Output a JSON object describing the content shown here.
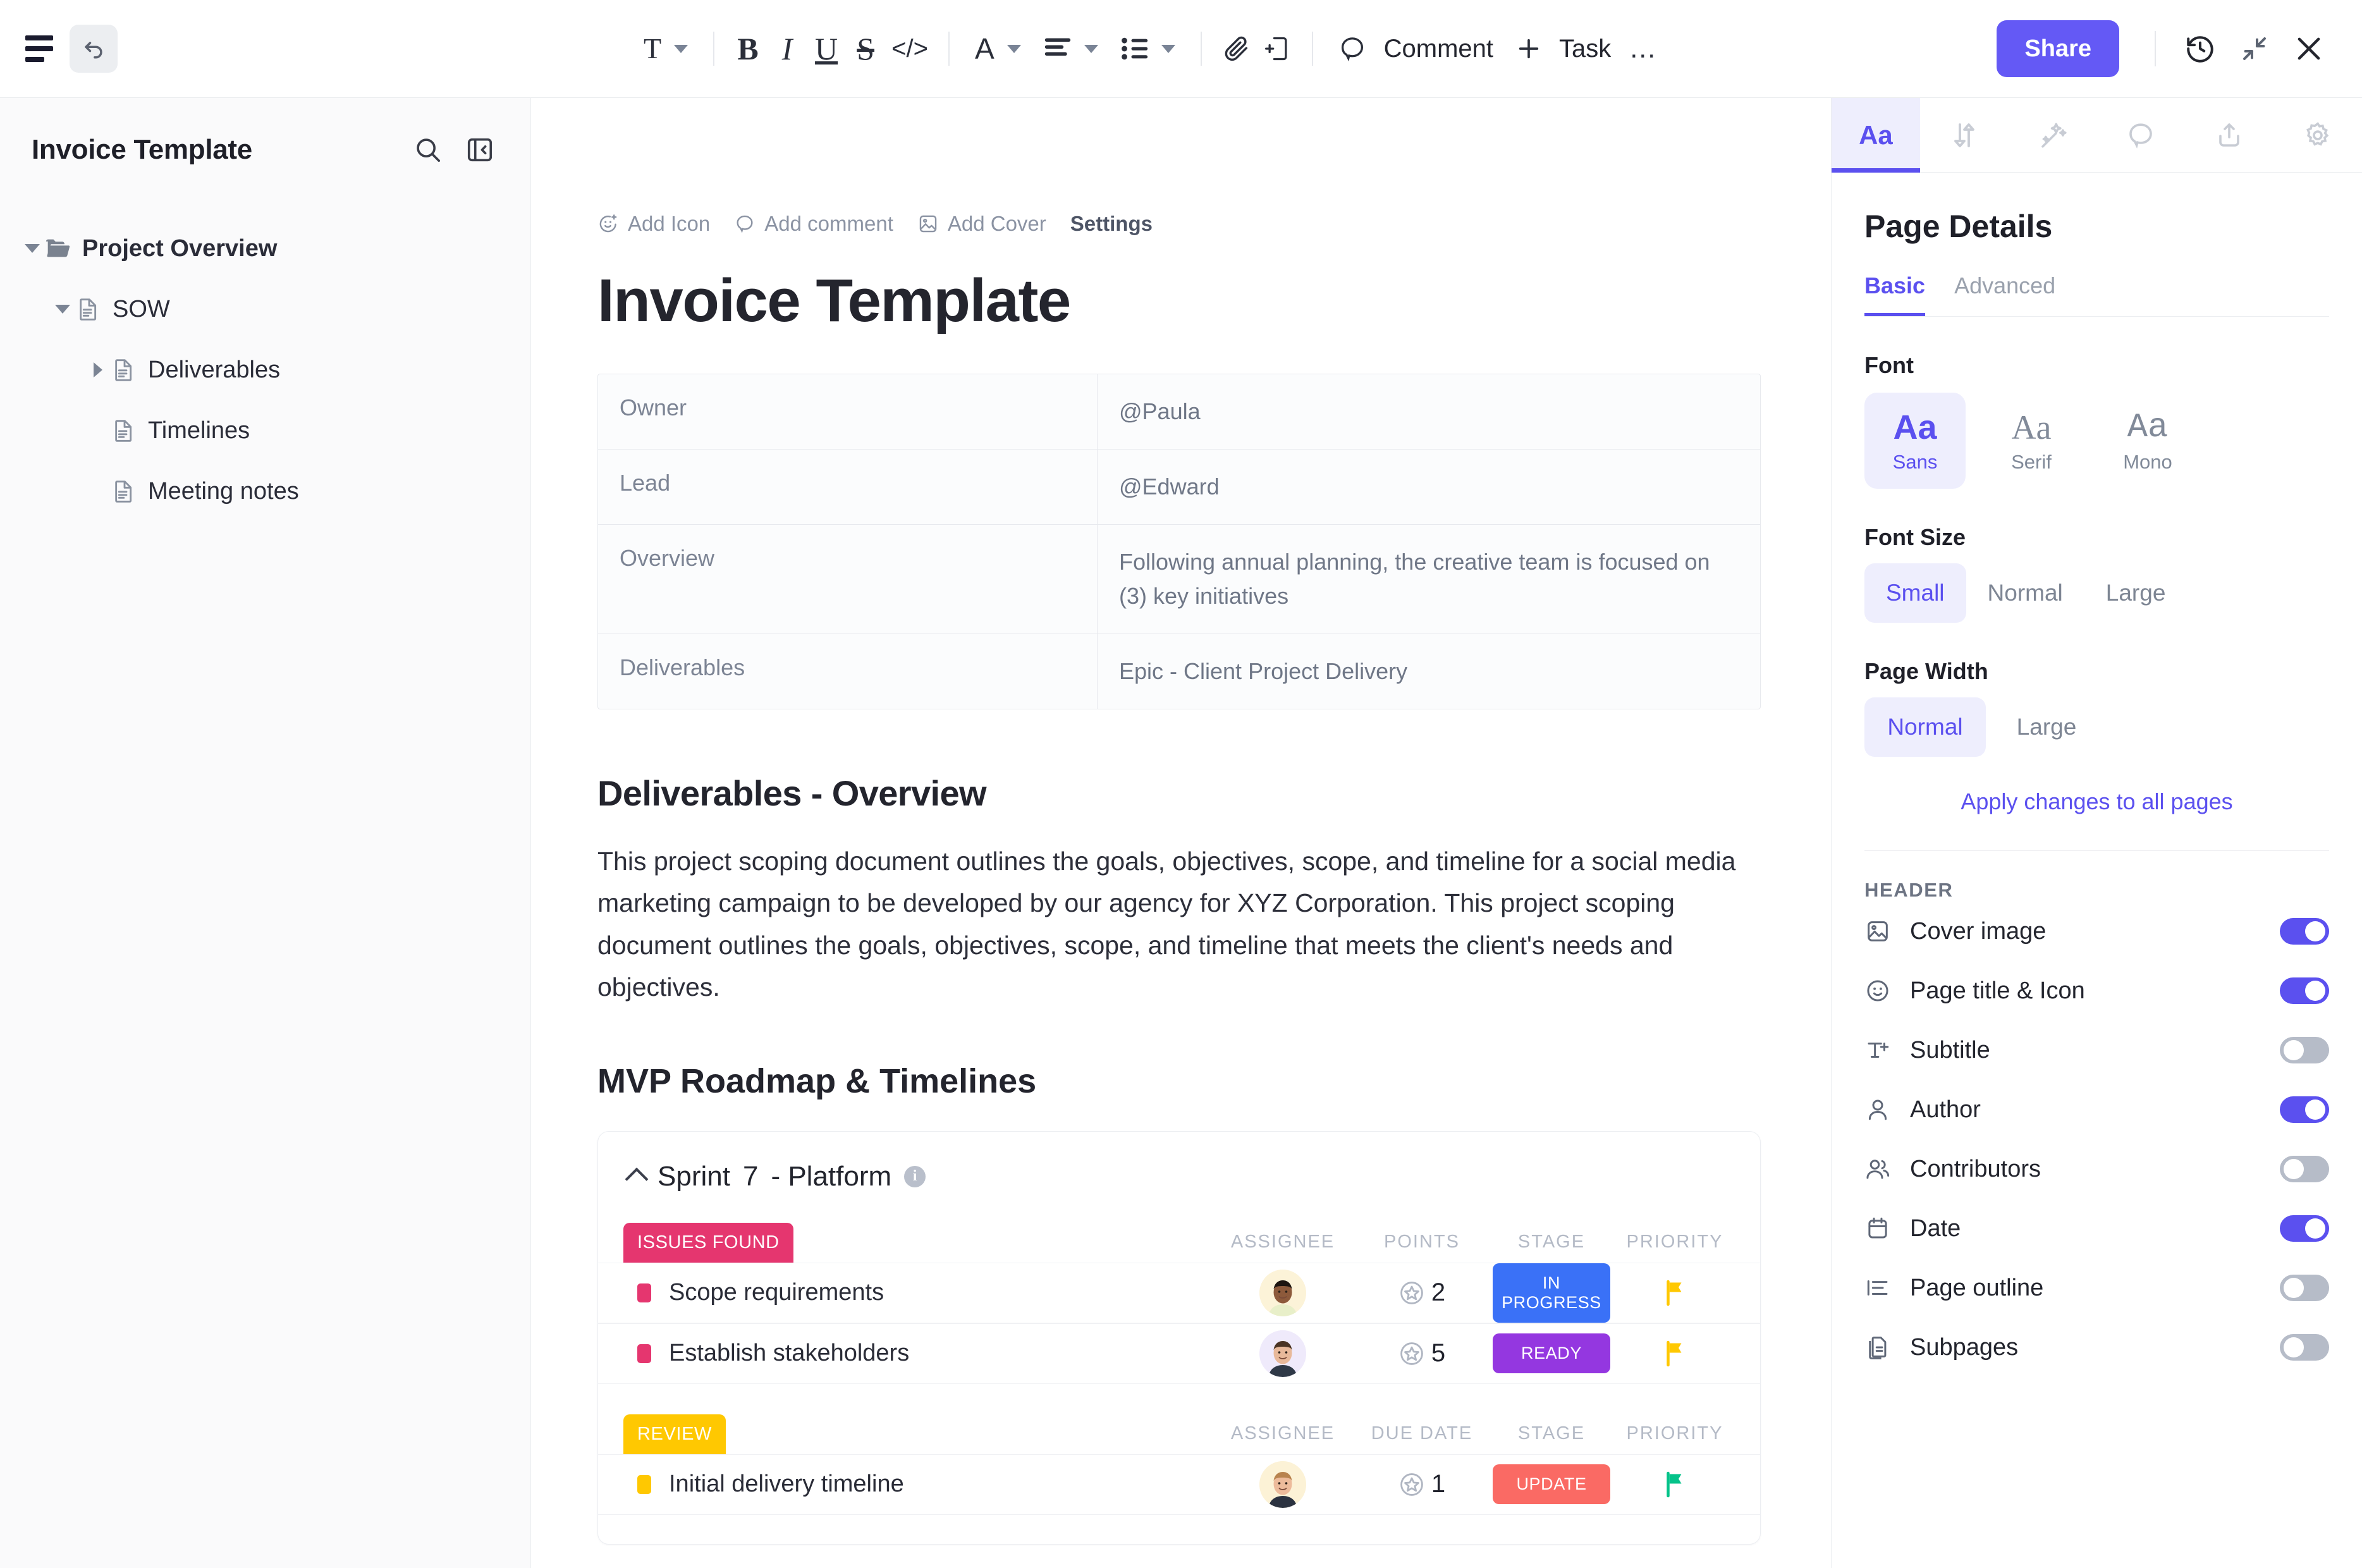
{
  "toolbar": {
    "menu_icon": "hamburger-icon",
    "undo_icon": "undo-icon",
    "text_style": "T",
    "bold": "B",
    "italic": "I",
    "underline": "U",
    "strikethrough": "S",
    "code": "</>",
    "font_color": "A",
    "comment_label": "Comment",
    "task_label": "Task",
    "more_label": "…",
    "share_label": "Share",
    "history_icon": "history-clock-icon",
    "collapse_icon": "collapse-arrows-icon",
    "close_icon": "close-icon"
  },
  "sidebar": {
    "title": "Invoice Template",
    "search_icon": "search-icon",
    "collapse_icon": "panel-collapse-icon",
    "items": [
      {
        "label": "Project Overview",
        "level": 1,
        "icon": "folder-icon",
        "expanded": true,
        "bold": true
      },
      {
        "label": "SOW",
        "level": 2,
        "icon": "document-icon",
        "expanded": true,
        "bold": false
      },
      {
        "label": "Deliverables",
        "level": 3,
        "icon": "document-icon",
        "expanded": false,
        "bold": false
      },
      {
        "label": "Timelines",
        "level": 3,
        "icon": "document-icon",
        "expanded": null,
        "bold": false
      },
      {
        "label": "Meeting notes",
        "level": 3,
        "icon": "document-icon",
        "expanded": null,
        "bold": false
      }
    ]
  },
  "document": {
    "actions": [
      {
        "label": "Add Icon",
        "icon": "smiley-plus-icon"
      },
      {
        "label": "Add comment",
        "icon": "comment-icon"
      },
      {
        "label": "Add Cover",
        "icon": "image-icon"
      },
      {
        "label": "Settings",
        "icon": null
      }
    ],
    "title": "Invoice Template",
    "info_table": [
      {
        "key": "Owner",
        "value": "@Paula"
      },
      {
        "key": "Lead",
        "value": "@Edward"
      },
      {
        "key": "Overview",
        "value": "Following annual planning, the creative team is focused on (3) key initiatives"
      },
      {
        "key": "Deliverables",
        "value": "Epic - Client Project Delivery"
      }
    ],
    "heading_1": "Deliverables - Overview",
    "paragraph_1": "This project scoping document outlines the goals, objectives, scope, and timeline for a social media marketing campaign to be developed by our agency for XYZ Corporation. This project scoping document outlines the goals, objectives, scope, and timeline that meets the client's needs and objectives.",
    "heading_2": "MVP Roadmap & Timelines"
  },
  "sprint": {
    "title_prefix": "Sprint",
    "number": "7",
    "title_suffix": "- Platform",
    "info_icon": "info-icon",
    "collapse_icon": "chevron-up-icon",
    "groups": [
      {
        "badge": "ISSUES FOUND",
        "badge_color": "#e5366f",
        "columns": [
          "ASSIGNEE",
          "POINTS",
          "STAGE",
          "PRIORITY"
        ],
        "tasks": [
          {
            "name": "Scope requirements",
            "dot_color": "#e5366f",
            "avatar_bg": "#fcf3d8",
            "avatar_name": "assignee-avatar",
            "points": "2",
            "stage": "IN PROGRESS",
            "stage_color": "#3a71f7",
            "priority_flag_color": "#ffc801"
          },
          {
            "name": "Establish stakeholders",
            "dot_color": "#e5366f",
            "avatar_bg": "#efeafb",
            "avatar_name": "assignee-avatar",
            "points": "5",
            "stage": "READY",
            "stage_color": "#9437e0",
            "priority_flag_color": "#ffc801"
          }
        ]
      },
      {
        "badge": "REVIEW",
        "badge_color": "#ffc801",
        "columns": [
          "ASSIGNEE",
          "DUE DATE",
          "STAGE",
          "PRIORITY"
        ],
        "tasks": [
          {
            "name": "Initial delivery timeline",
            "dot_color": "#ffc801",
            "avatar_bg": "#fcf2d6",
            "avatar_name": "assignee-avatar",
            "points": "1",
            "stage": "UPDATE",
            "stage_color": "#fa6a64",
            "priority_flag_color": "#05c38a"
          }
        ]
      }
    ]
  },
  "right_panel": {
    "tabs": [
      {
        "name": "font-tab",
        "label": "Aa",
        "active": true
      },
      {
        "name": "relationships-tab",
        "label": "",
        "icon": "arrows-icon",
        "active": false
      },
      {
        "name": "ai-tab",
        "label": "",
        "icon": "magic-wand-icon",
        "active": false
      },
      {
        "name": "comments-tab",
        "label": "",
        "icon": "comment-icon",
        "active": false
      },
      {
        "name": "share-tab",
        "label": "",
        "icon": "upload-icon",
        "active": false
      },
      {
        "name": "settings-tab",
        "label": "",
        "icon": "gear-icon",
        "active": false
      }
    ],
    "title": "Page Details",
    "subtabs": [
      {
        "label": "Basic",
        "active": true
      },
      {
        "label": "Advanced",
        "active": false
      }
    ],
    "font_section_label": "Font",
    "font_options": [
      {
        "sample": "Aa",
        "label": "Sans",
        "selected": true
      },
      {
        "sample": "Aa",
        "label": "Serif",
        "selected": false
      },
      {
        "sample": "Aa",
        "label": "Mono",
        "selected": false
      }
    ],
    "font_size_label": "Font Size",
    "font_sizes": [
      {
        "label": "Small",
        "selected": true
      },
      {
        "label": "Normal",
        "selected": false
      },
      {
        "label": "Large",
        "selected": false
      }
    ],
    "page_width_label": "Page Width",
    "page_widths": [
      {
        "label": "Normal",
        "selected": true
      },
      {
        "label": "Large",
        "selected": false
      }
    ],
    "apply_link": "Apply changes to all pages",
    "header_label": "HEADER",
    "header_toggles": [
      {
        "label": "Cover image",
        "icon": "image-icon",
        "on": true
      },
      {
        "label": "Page title & Icon",
        "icon": "smiley-icon",
        "on": true
      },
      {
        "label": "Subtitle",
        "icon": "text-plus-icon",
        "on": false
      },
      {
        "label": "Author",
        "icon": "user-icon",
        "on": true
      },
      {
        "label": "Contributors",
        "icon": "users-icon",
        "on": false
      },
      {
        "label": "Date",
        "icon": "calendar-icon",
        "on": true
      },
      {
        "label": "Page outline",
        "icon": "list-icon",
        "on": false
      },
      {
        "label": "Subpages",
        "icon": "pages-icon",
        "on": false
      }
    ]
  },
  "colors": {
    "accent": "#5b50ef",
    "share": "#6459f5"
  }
}
